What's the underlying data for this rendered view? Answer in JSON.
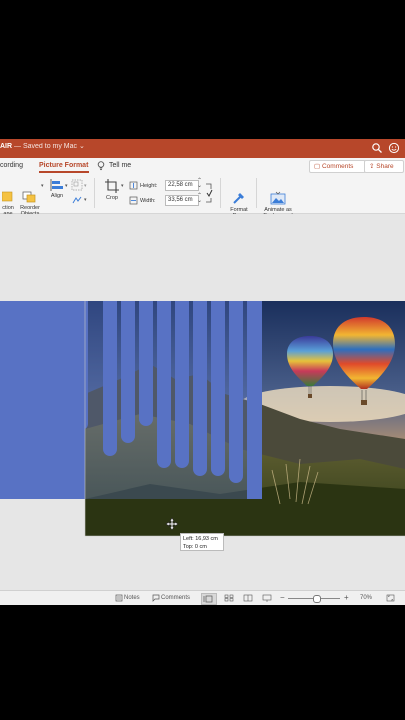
{
  "titlebar": {
    "app_name": "AIR",
    "saved_status": " — Saved to my Mac ⌄"
  },
  "tabs": [
    {
      "label": "cording"
    },
    {
      "label": "Picture Format"
    },
    {
      "label": "Tell me"
    }
  ],
  "tab_buttons": {
    "comments": "Comments",
    "share": "Share"
  },
  "ribbon": {
    "selection_pane": "ction\nane",
    "reorder_objects": "Reorder\nObjects",
    "align": "Align",
    "crop": "Crop",
    "height_label": "Height:",
    "height_value": "22,58 cm",
    "width_label": "Width:",
    "width_value": "33,56 cm",
    "format_pane": "Format\nPane",
    "animate_background": "Animate as\nBackground"
  },
  "tooltip": {
    "left": "Left: 16,93 cm",
    "top": "Top: 0 cm"
  },
  "statusbar": {
    "notes": "Notes",
    "comments": "Comments",
    "zoom": "70%",
    "zoom_level": 0.55
  },
  "colors": {
    "accent": "#b7472a",
    "slide_blue": "#5872c4"
  }
}
